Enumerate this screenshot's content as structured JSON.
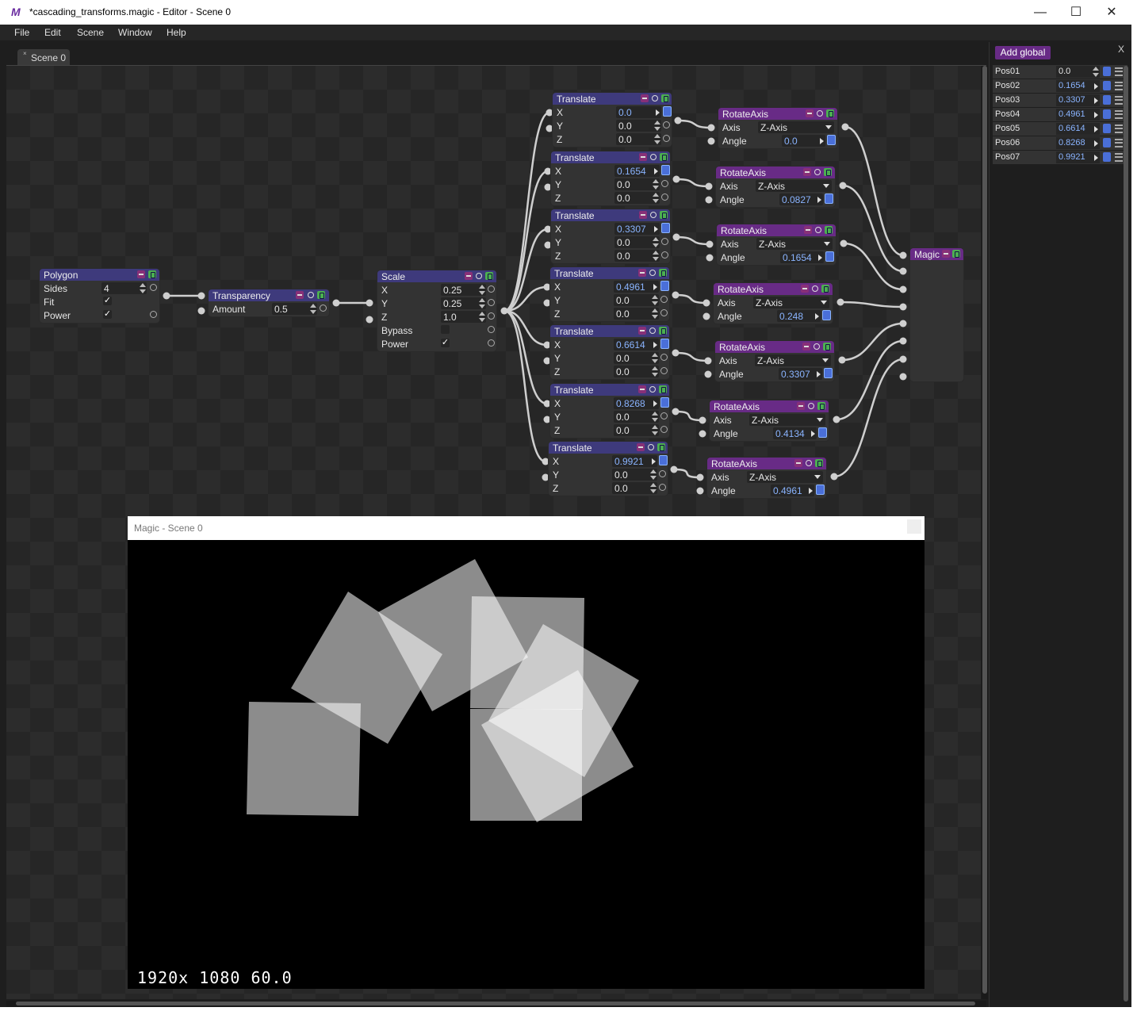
{
  "window": {
    "title": "*cascading_transforms.magic - Editor - Scene 0",
    "logo": "M"
  },
  "menu": [
    "File",
    "Edit",
    "Scene",
    "Window",
    "Help"
  ],
  "tab": {
    "label": "Scene 0",
    "close": "×"
  },
  "nodes": {
    "polygon": {
      "title": "Polygon",
      "sides_label": "Sides",
      "sides": "4",
      "fit_label": "Fit",
      "power_label": "Power",
      "check": "✓"
    },
    "transparency": {
      "title": "Transparency",
      "amount_label": "Amount",
      "amount": "0.5"
    },
    "scale": {
      "title": "Scale",
      "x": "0.25",
      "y": "0.25",
      "z": "1.0",
      "bypass_label": "Bypass",
      "power_label": "Power"
    },
    "translate": [
      {
        "title": "Translate",
        "x": "0.0",
        "y": "0.0",
        "z": "0.0"
      },
      {
        "title": "Translate",
        "x": "0.1654",
        "y": "0.0",
        "z": "0.0"
      },
      {
        "title": "Translate",
        "x": "0.3307",
        "y": "0.0",
        "z": "0.0"
      },
      {
        "title": "Translate",
        "x": "0.4961",
        "y": "0.0",
        "z": "0.0"
      },
      {
        "title": "Translate",
        "x": "0.6614",
        "y": "0.0",
        "z": "0.0"
      },
      {
        "title": "Translate",
        "x": "0.8268",
        "y": "0.0",
        "z": "0.0"
      },
      {
        "title": "Translate",
        "x": "0.9921",
        "y": "0.0",
        "z": "0.0"
      }
    ],
    "rotate": [
      {
        "title": "RotateAxis",
        "axis": "Z-Axis",
        "angle": "0.0"
      },
      {
        "title": "RotateAxis",
        "axis": "Z-Axis",
        "angle": "0.0827"
      },
      {
        "title": "RotateAxis",
        "axis": "Z-Axis",
        "angle": "0.1654"
      },
      {
        "title": "RotateAxis",
        "axis": "Z-Axis",
        "angle": "0.248"
      },
      {
        "title": "RotateAxis",
        "axis": "Z-Axis",
        "angle": "0.3307"
      },
      {
        "title": "RotateAxis",
        "axis": "Z-Axis",
        "angle": "0.4134"
      },
      {
        "title": "RotateAxis",
        "axis": "Z-Axis",
        "angle": "0.4961"
      }
    ],
    "magic": {
      "title": "Magic"
    },
    "labels": {
      "x": "X",
      "y": "Y",
      "z": "Z",
      "axis": "Axis",
      "angle": "Angle"
    }
  },
  "globals": {
    "add_label": "Add global",
    "close": "X",
    "items": [
      {
        "name": "Pos01",
        "value": "0.0"
      },
      {
        "name": "Pos02",
        "value": "0.1654"
      },
      {
        "name": "Pos03",
        "value": "0.3307"
      },
      {
        "name": "Pos04",
        "value": "0.4961"
      },
      {
        "name": "Pos05",
        "value": "0.6614"
      },
      {
        "name": "Pos06",
        "value": "0.8268"
      },
      {
        "name": "Pos07",
        "value": "0.9921"
      }
    ]
  },
  "preview": {
    "title": "Magic - Scene 0",
    "stats": "1920x 1080  60.0"
  },
  "colors": {
    "translate_header": "#3e3a7c",
    "rotate_header": "#682b86",
    "power_on": "#4caf50",
    "link_active": "#4a6fd8"
  }
}
